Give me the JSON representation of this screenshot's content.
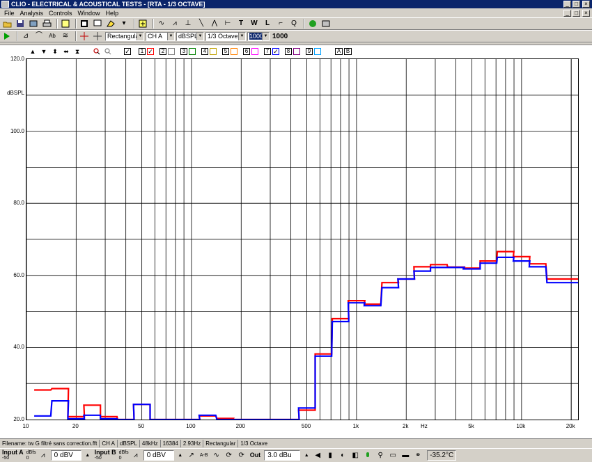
{
  "window": {
    "title": "CLIO - ELECTRICAL & ACOUSTICAL TESTS - [RTA - 1/3 OCTAVE]",
    "controls": [
      "_",
      "□",
      "×"
    ]
  },
  "menu": {
    "items": [
      "File",
      "Analysis",
      "Controls",
      "Window",
      "Help"
    ]
  },
  "toolbar2": {
    "window_combo": "Rectangular",
    "channel_combo": "CH A",
    "unit_combo": "dBSPL",
    "band_combo": "1/3 Octave",
    "avg_combo": "1000",
    "avg_value": "1000"
  },
  "graph_toolbar": {
    "channels": [
      "1",
      "2",
      "3",
      "4",
      "5",
      "6",
      "7",
      "8",
      "9"
    ],
    "channel_colors": [
      "#ff0000",
      "#808080",
      "#008000",
      "#c0a000",
      "#ff8000",
      "#ff00ff",
      "#0000ff",
      "#800080",
      "#00a0ff"
    ],
    "ab_buttons": [
      "A",
      "B"
    ]
  },
  "chart_data": {
    "type": "line",
    "x_scale": "log",
    "xlim": [
      10,
      22000
    ],
    "ylim": [
      20,
      120
    ],
    "ylabel": "dBSPL",
    "xlabel": "Hz",
    "y_ticks": [
      "120.0",
      "100.0",
      "80.0",
      "60.0",
      "40.0",
      "20.0"
    ],
    "x_ticks": [
      "10",
      "20",
      "50",
      "100",
      "200",
      "500",
      "1k",
      "2k",
      "5k",
      "10k",
      "20k"
    ],
    "grid": true,
    "bands": [
      12.5,
      16,
      20,
      25,
      31.5,
      40,
      50,
      63,
      80,
      100,
      125,
      160,
      200,
      250,
      315,
      400,
      500,
      630,
      800,
      1000,
      1250,
      1600,
      2000,
      2500,
      3150,
      4000,
      5000,
      6300,
      8000,
      10000,
      12500,
      16000,
      20000
    ],
    "series": [
      {
        "color": "#ff0000",
        "values": [
          28.2,
          28.6,
          20.8,
          24.0,
          20.8,
          20,
          24.2,
          20,
          20,
          20,
          21.0,
          20.3,
          20,
          20,
          20,
          20,
          22.6,
          38.2,
          48.0,
          53.0,
          52.0,
          58.0,
          59.0,
          62.4,
          63.0,
          62.3,
          62.0,
          64.0,
          66.6,
          65.2,
          63.2,
          59.0,
          59.0
        ]
      },
      {
        "color": "#0000ff",
        "values": [
          21.0,
          25.2,
          20.2,
          21.2,
          20.2,
          20,
          24.2,
          20,
          20,
          20,
          21.2,
          20,
          20,
          20,
          20,
          20,
          23.2,
          37.6,
          47.2,
          52.4,
          51.6,
          56.6,
          59.0,
          61.2,
          62.2,
          62.2,
          61.8,
          63.4,
          65.0,
          64.0,
          62.4,
          58.0,
          58.0
        ]
      }
    ]
  },
  "infobar": {
    "filename": "Filename: tw G filtré sans correction.fft",
    "channel": "CH A",
    "unit": "dBSPL",
    "rate": "48kHz",
    "size": "16384",
    "resolution": "2.93Hz",
    "window": "Rectangular",
    "band": "1/3 Octave"
  },
  "bottombar": {
    "input_a_label": "Input A",
    "input_a_range": "-50",
    "input_a_unit": "dBfs",
    "input_a_zero": "0",
    "input_a_value": "0 dBV",
    "input_b_label": "Input B",
    "input_b_range": "-50",
    "input_b_unit": "dBfs",
    "input_b_zero": "0",
    "input_b_value": "0 dBV",
    "ab_label": "A-B",
    "out_label": "Out",
    "out_value": "3.0 dBu",
    "temperature": "-35.2°C"
  }
}
